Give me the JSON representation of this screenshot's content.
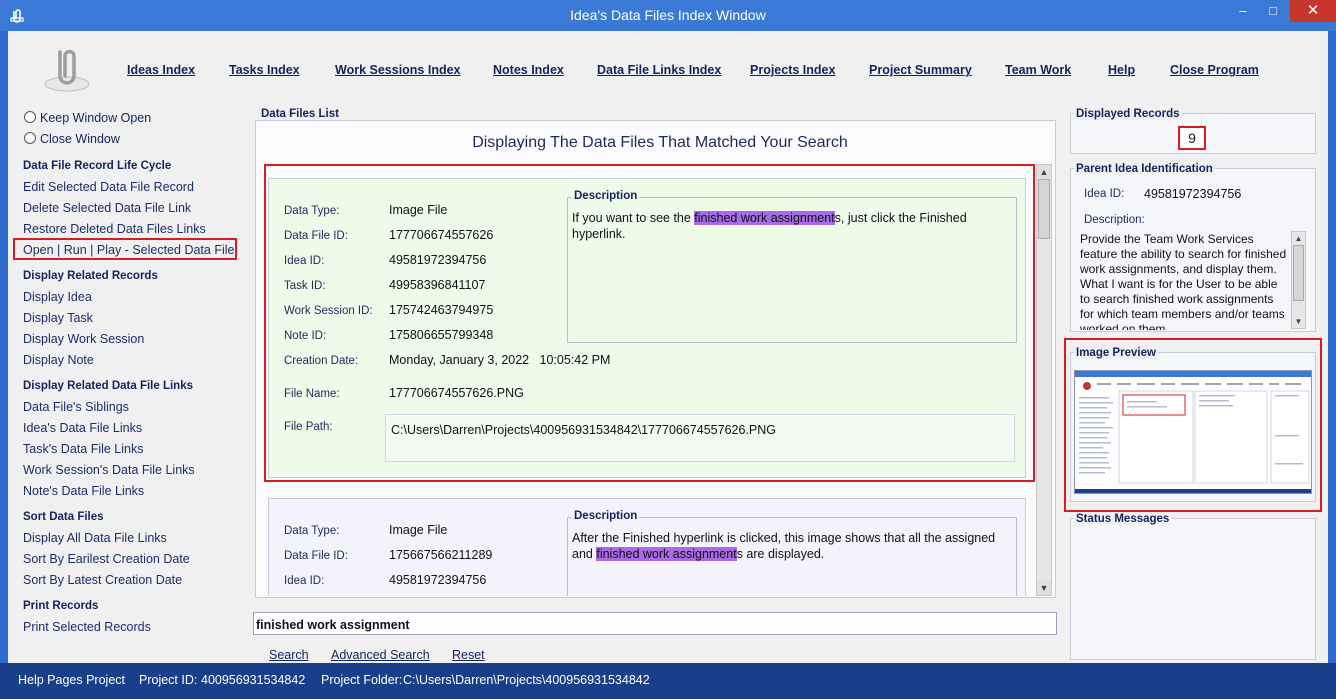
{
  "window": {
    "title": "Idea's Data Files Index Window",
    "min": "–",
    "max": "□",
    "close": "✕"
  },
  "menu": [
    "Ideas Index",
    "Tasks Index",
    "Work Sessions Index",
    "Notes Index",
    "Data File Links Index",
    "Projects Index",
    "Project Summary",
    "Team Work",
    "Help",
    "Close Program"
  ],
  "left": {
    "keep_open": "Keep Window Open",
    "close_window": "Close Window",
    "sections": [
      {
        "title": "Data File Record Life Cycle",
        "links": [
          "Edit Selected Data File Record",
          "Delete Selected Data File Link",
          "Restore Deleted Data Files Links",
          "Open | Run | Play - Selected Data File"
        ]
      },
      {
        "title": "Display Related Records",
        "links": [
          "Display Idea",
          "Display Task",
          "Display Work Session",
          "Display Note"
        ]
      },
      {
        "title": "Display Related Data File Links",
        "links": [
          "Data File's Siblings",
          "Idea's Data File Links",
          "Task's Data File Links",
          "Work Session's Data File Links",
          "Note's Data File Links"
        ]
      },
      {
        "title": "Sort Data Files",
        "links": [
          "Display All Data File Links",
          "Sort By Earilest Creation Date",
          "Sort By Latest Creation Date"
        ]
      },
      {
        "title": "Print Records",
        "links": [
          "Print Selected Records"
        ]
      }
    ]
  },
  "list": {
    "group_title": "Data Files List",
    "heading": "Displaying The Data Files That Matched Your Search",
    "labels": {
      "data_type": "Data Type:",
      "data_file_id": "Data File ID:",
      "idea_id": "Idea ID:",
      "task_id": "Task ID:",
      "work_session_id": "Work Session ID:",
      "note_id": "Note ID:",
      "creation_date": "Creation Date:",
      "file_name": "File Name:",
      "file_path": "File Path:",
      "description": "Description"
    },
    "records": [
      {
        "data_type": "Image File",
        "data_file_id": "177706674557626",
        "idea_id": "49581972394756",
        "task_id": "49958396841107",
        "work_session_id": "175742463794975",
        "note_id": "175806655799348",
        "creation_date": "Monday, January 3, 2022   10:05:42 PM",
        "file_name": "177706674557626.PNG",
        "file_path": "C:\\Users\\Darren\\Projects\\400956931534842\\177706674557626.PNG",
        "desc_before": "If you want to see the ",
        "desc_highlight": "finished work assignment",
        "desc_after": "s, just click the Finished hyperlink."
      },
      {
        "data_type": "Image File",
        "data_file_id": "175667566211289",
        "idea_id": "49581972394756",
        "desc_before": "After the Finished hyperlink is clicked, this image shows that all the assigned and ",
        "desc_highlight": "finished work assignment",
        "desc_after": "s are displayed."
      }
    ]
  },
  "search": {
    "value": "finished work assignment",
    "search_label": "Search",
    "advanced_label": "Advanced Search",
    "reset_label": "Reset"
  },
  "right": {
    "displayed_records_title": "Displayed Records",
    "displayed_records_count": "9",
    "parent_title": "Parent Idea Identification",
    "idea_id_label": "Idea ID:",
    "idea_id_value": "49581972394756",
    "description_label": "Description:",
    "description_text": "Provide the Team Work Services feature the ability to search for finished work assignments, and display them. What I want is for the User to be able to search finished work assignments for which team members and/or teams worked on them.",
    "image_preview_title": "Image Preview",
    "status_title": "Status Messages"
  },
  "statusbar": {
    "project": "Help Pages Project",
    "project_id_label": "Project ID:",
    "project_id": "400956931534842",
    "folder_label": "Project Folder:",
    "folder": "C:\\Users\\Darren\\Projects\\400956931534842"
  },
  "icons": {
    "app": "paperclip-icon",
    "logo": "paperclip-logo"
  },
  "colors": {
    "title_bar": "#3a7ad6",
    "status_bar": "#1a3f8a",
    "highlight": "#a96ae8",
    "selection_border": "#d81b24",
    "record_bg_selected": "#eefbe9",
    "record_bg": "#f3f4fb"
  }
}
